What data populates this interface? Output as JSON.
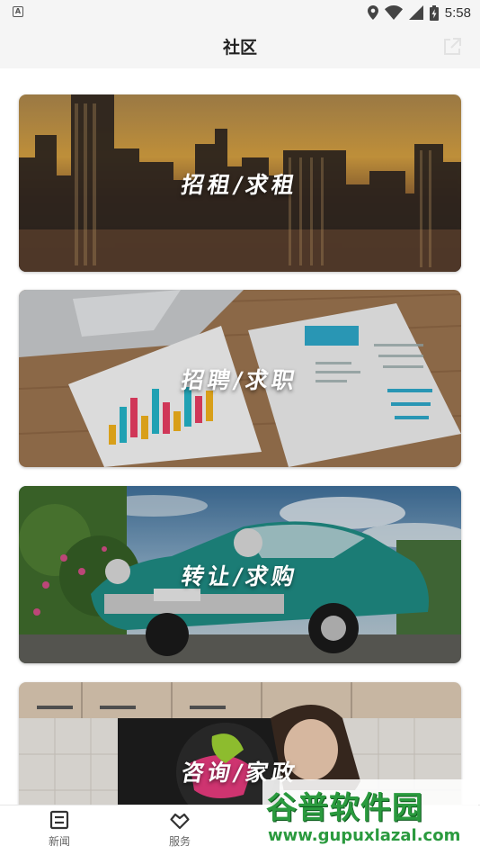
{
  "status_bar": {
    "notification_icon_letter": "A",
    "time": "5:58",
    "icons": [
      "location-icon",
      "wifi-icon",
      "signal-icon",
      "battery-charging-icon"
    ]
  },
  "header": {
    "title": "社区",
    "share_icon": "share-icon"
  },
  "cards": [
    {
      "label": "招租/求租",
      "scene": "city-skyline-sunset"
    },
    {
      "label": "招聘/求职",
      "scene": "resume-papers-on-desk"
    },
    {
      "label": "转让/求购",
      "scene": "vintage-car"
    },
    {
      "label": "咨询/家政",
      "scene": "housekeeping-kitchen"
    }
  ],
  "bottom_nav": {
    "items": [
      {
        "label": "新闻",
        "icon": "news-icon"
      },
      {
        "label": "服务",
        "icon": "service-heart-icon"
      }
    ]
  },
  "watermark": {
    "text": "谷普软件园",
    "url": "www.gupuxlazal.com"
  },
  "colors": {
    "status_bar_bg": "#f5f5f5",
    "watermark_green": "#2a9a3e"
  }
}
